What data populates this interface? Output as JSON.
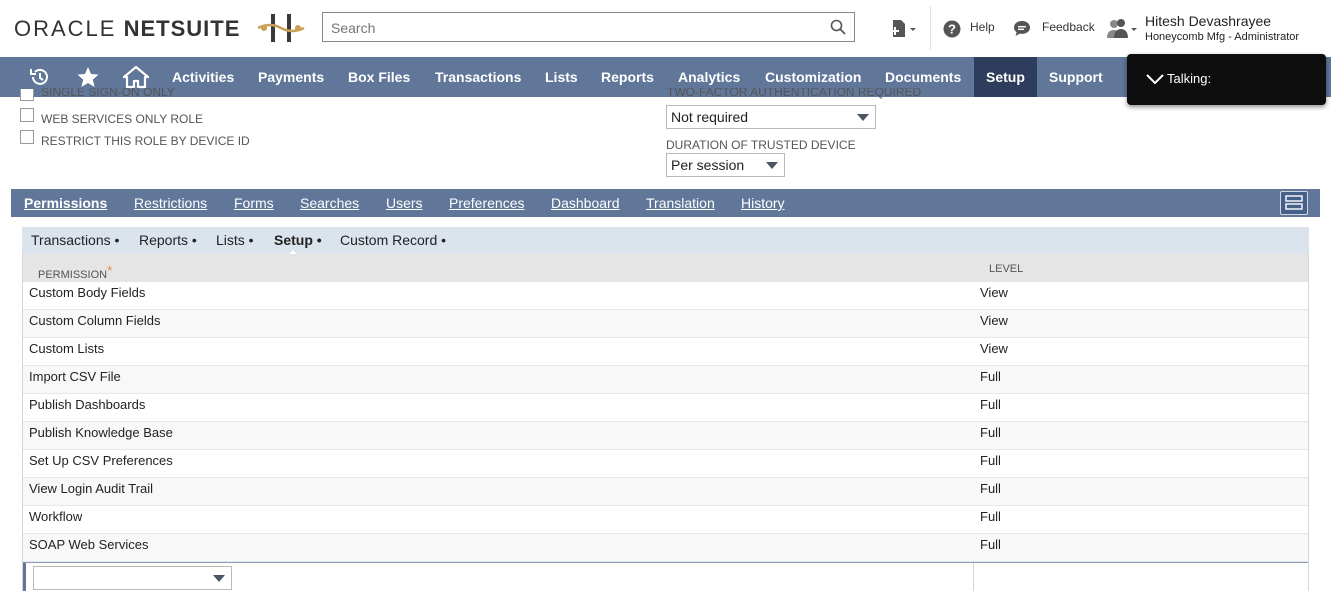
{
  "header": {
    "logo_brand": "ORACLE",
    "logo_product": "NETSUITE",
    "search_placeholder": "Search",
    "help_label": "Help",
    "feedback_label": "Feedback",
    "user_name": "Hitesh Devashrayee",
    "user_role": "Honeycomb Mfg - Administrator"
  },
  "nav": {
    "items": [
      "Activities",
      "Payments",
      "Box Files",
      "Transactions",
      "Lists",
      "Reports",
      "Analytics",
      "Customization",
      "Documents",
      "Setup",
      "Support"
    ],
    "active": "Setup"
  },
  "talking": {
    "label": "Talking:"
  },
  "form": {
    "checkbox_single_sign_on": "SINGLE SIGN-ON ONLY",
    "checkbox_web_services": "WEB SERVICES ONLY ROLE",
    "checkbox_restrict_device": "RESTRICT THIS ROLE BY DEVICE ID",
    "two_factor_label": "TWO-FACTOR AUTHENTICATION REQUIRED",
    "two_factor_value": "Not required",
    "trusted_device_label": "DURATION OF TRUSTED DEVICE",
    "trusted_device_value": "Per session"
  },
  "subtabs": [
    "Permissions",
    "Restrictions",
    "Forms",
    "Searches",
    "Users",
    "Preferences",
    "Dashboard",
    "Translation",
    "History"
  ],
  "inner_tabs": [
    "Transactions",
    "Reports",
    "Lists",
    "Setup",
    "Custom Record"
  ],
  "table": {
    "col_permission": "PERMISSION",
    "col_required_mark": "*",
    "col_level": "LEVEL",
    "rows": [
      {
        "permission": "Custom Body Fields",
        "level": "View"
      },
      {
        "permission": "Custom Column Fields",
        "level": "View"
      },
      {
        "permission": "Custom Lists",
        "level": "View"
      },
      {
        "permission": "Import CSV File",
        "level": "Full"
      },
      {
        "permission": "Publish Dashboards",
        "level": "Full"
      },
      {
        "permission": "Publish Knowledge Base",
        "level": "Full"
      },
      {
        "permission": "Set Up CSV Preferences",
        "level": "Full"
      },
      {
        "permission": "View Login Audit Trail",
        "level": "Full"
      },
      {
        "permission": "Workflow",
        "level": "Full"
      },
      {
        "permission": "SOAP Web Services",
        "level": "Full"
      }
    ]
  },
  "colors": {
    "nav_bg": "#607799",
    "nav_active": "#2e3d5c",
    "panel_bg": "#dbe3ed",
    "header_row": "#e5e5e5",
    "required_mark": "#e08a2a"
  }
}
